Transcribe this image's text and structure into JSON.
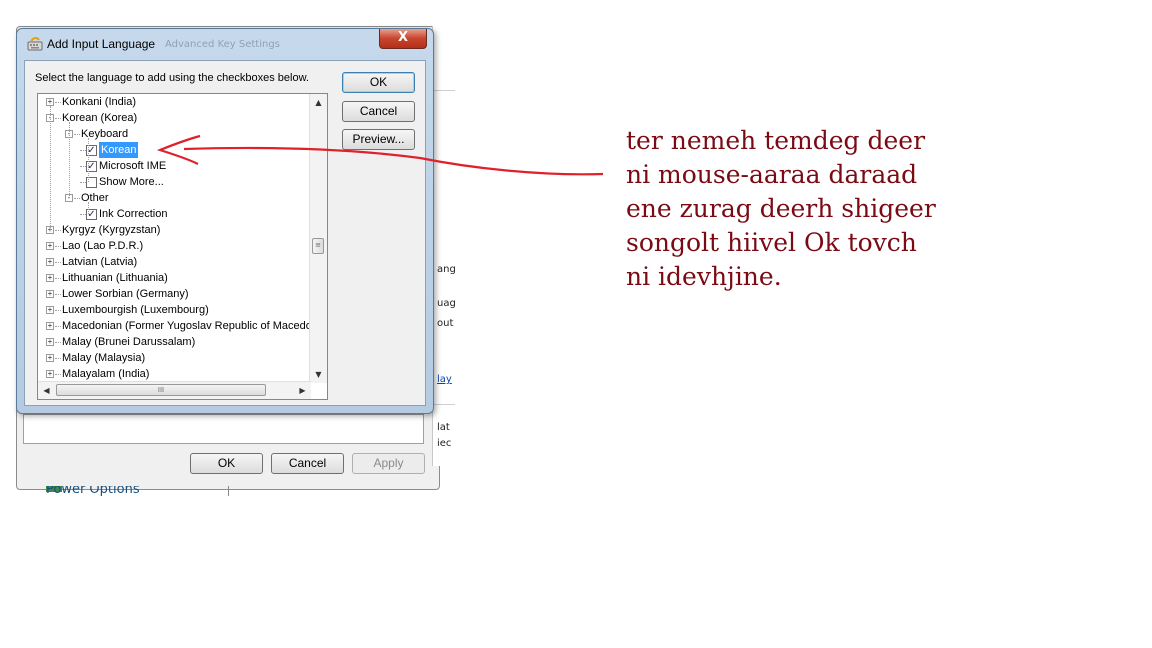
{
  "background_window": {
    "ok_label": "OK",
    "cancel_label": "Cancel",
    "apply_label": "Apply",
    "power_text": "Power Options",
    "right_fragments": [
      {
        "text": "ang",
        "link": false
      },
      {
        "text": "uag",
        "link": false
      },
      {
        "text": "out",
        "link": false
      },
      {
        "text": "lay",
        "link": true
      },
      {
        "text": "lat",
        "link": false
      },
      {
        "text": "iec",
        "link": false
      }
    ]
  },
  "dialog": {
    "title": "Add Input Language",
    "title_ghost": "Advanced Key Settings",
    "close_label": "X",
    "instruction": "Select the language to add using the checkboxes below.",
    "buttons": {
      "ok": "OK",
      "cancel": "Cancel",
      "preview": "Preview..."
    },
    "tree": [
      {
        "label": "Konkani (India)",
        "level": 0,
        "expander": "+"
      },
      {
        "label": "Korean (Korea)",
        "level": 0,
        "expander": "-"
      },
      {
        "label": "Keyboard",
        "level": 1,
        "expander": "-"
      },
      {
        "label": "Korean",
        "level": 2,
        "checked": true,
        "selected": true
      },
      {
        "label": "Microsoft IME",
        "level": 2,
        "checked": true
      },
      {
        "label": "Show More...",
        "level": 2,
        "checked": false
      },
      {
        "label": "Other",
        "level": 1,
        "expander": "-"
      },
      {
        "label": "Ink Correction",
        "level": 2,
        "checked": true
      },
      {
        "label": "Kyrgyz (Kyrgyzstan)",
        "level": 0,
        "expander": "+"
      },
      {
        "label": "Lao (Lao P.D.R.)",
        "level": 0,
        "expander": "+"
      },
      {
        "label": "Latvian (Latvia)",
        "level": 0,
        "expander": "+"
      },
      {
        "label": "Lithuanian (Lithuania)",
        "level": 0,
        "expander": "+"
      },
      {
        "label": "Lower Sorbian (Germany)",
        "level": 0,
        "expander": "+"
      },
      {
        "label": "Luxembourgish (Luxembourg)",
        "level": 0,
        "expander": "+"
      },
      {
        "label": "Macedonian (Former Yugoslav Republic of Macedon",
        "level": 0,
        "expander": "+"
      },
      {
        "label": "Malay (Brunei Darussalam)",
        "level": 0,
        "expander": "+"
      },
      {
        "label": "Malay (Malaysia)",
        "level": 0,
        "expander": "+"
      },
      {
        "label": "Malayalam (India)",
        "level": 0,
        "expander": "+"
      }
    ],
    "scroll_grip": "III"
  },
  "annotation": {
    "lines": [
      "ter nemeh temdeg deer",
      "ni mouse-aaraa daraad",
      "ene zurag deerh shigeer",
      "songolt hiivel Ok tovch",
      "ni idevhjine."
    ],
    "color": "#7a0a14",
    "arrow_color": "#e0202a"
  }
}
